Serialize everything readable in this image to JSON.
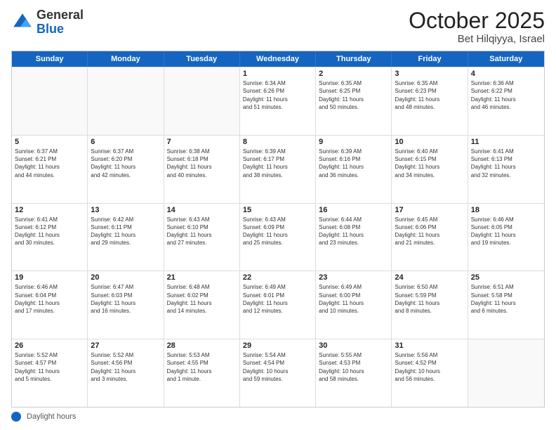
{
  "header": {
    "logo_general": "General",
    "logo_blue": "Blue",
    "month": "October 2025",
    "location": "Bet Hilqiyya, Israel"
  },
  "days_of_week": [
    "Sunday",
    "Monday",
    "Tuesday",
    "Wednesday",
    "Thursday",
    "Friday",
    "Saturday"
  ],
  "weeks": [
    [
      {
        "day": "",
        "info": ""
      },
      {
        "day": "",
        "info": ""
      },
      {
        "day": "",
        "info": ""
      },
      {
        "day": "1",
        "info": "Sunrise: 6:34 AM\nSunset: 6:26 PM\nDaylight: 11 hours\nand 51 minutes."
      },
      {
        "day": "2",
        "info": "Sunrise: 6:35 AM\nSunset: 6:25 PM\nDaylight: 11 hours\nand 50 minutes."
      },
      {
        "day": "3",
        "info": "Sunrise: 6:35 AM\nSunset: 6:23 PM\nDaylight: 11 hours\nand 48 minutes."
      },
      {
        "day": "4",
        "info": "Sunrise: 6:36 AM\nSunset: 6:22 PM\nDaylight: 11 hours\nand 46 minutes."
      }
    ],
    [
      {
        "day": "5",
        "info": "Sunrise: 6:37 AM\nSunset: 6:21 PM\nDaylight: 11 hours\nand 44 minutes."
      },
      {
        "day": "6",
        "info": "Sunrise: 6:37 AM\nSunset: 6:20 PM\nDaylight: 11 hours\nand 42 minutes."
      },
      {
        "day": "7",
        "info": "Sunrise: 6:38 AM\nSunset: 6:18 PM\nDaylight: 11 hours\nand 40 minutes."
      },
      {
        "day": "8",
        "info": "Sunrise: 6:39 AM\nSunset: 6:17 PM\nDaylight: 11 hours\nand 38 minutes."
      },
      {
        "day": "9",
        "info": "Sunrise: 6:39 AM\nSunset: 6:16 PM\nDaylight: 11 hours\nand 36 minutes."
      },
      {
        "day": "10",
        "info": "Sunrise: 6:40 AM\nSunset: 6:15 PM\nDaylight: 11 hours\nand 34 minutes."
      },
      {
        "day": "11",
        "info": "Sunrise: 6:41 AM\nSunset: 6:13 PM\nDaylight: 11 hours\nand 32 minutes."
      }
    ],
    [
      {
        "day": "12",
        "info": "Sunrise: 6:41 AM\nSunset: 6:12 PM\nDaylight: 11 hours\nand 30 minutes."
      },
      {
        "day": "13",
        "info": "Sunrise: 6:42 AM\nSunset: 6:11 PM\nDaylight: 11 hours\nand 29 minutes."
      },
      {
        "day": "14",
        "info": "Sunrise: 6:43 AM\nSunset: 6:10 PM\nDaylight: 11 hours\nand 27 minutes."
      },
      {
        "day": "15",
        "info": "Sunrise: 6:43 AM\nSunset: 6:09 PM\nDaylight: 11 hours\nand 25 minutes."
      },
      {
        "day": "16",
        "info": "Sunrise: 6:44 AM\nSunset: 6:08 PM\nDaylight: 11 hours\nand 23 minutes."
      },
      {
        "day": "17",
        "info": "Sunrise: 6:45 AM\nSunset: 6:06 PM\nDaylight: 11 hours\nand 21 minutes."
      },
      {
        "day": "18",
        "info": "Sunrise: 6:46 AM\nSunset: 6:05 PM\nDaylight: 11 hours\nand 19 minutes."
      }
    ],
    [
      {
        "day": "19",
        "info": "Sunrise: 6:46 AM\nSunset: 6:04 PM\nDaylight: 11 hours\nand 17 minutes."
      },
      {
        "day": "20",
        "info": "Sunrise: 6:47 AM\nSunset: 6:03 PM\nDaylight: 11 hours\nand 16 minutes."
      },
      {
        "day": "21",
        "info": "Sunrise: 6:48 AM\nSunset: 6:02 PM\nDaylight: 11 hours\nand 14 minutes."
      },
      {
        "day": "22",
        "info": "Sunrise: 6:49 AM\nSunset: 6:01 PM\nDaylight: 11 hours\nand 12 minutes."
      },
      {
        "day": "23",
        "info": "Sunrise: 6:49 AM\nSunset: 6:00 PM\nDaylight: 11 hours\nand 10 minutes."
      },
      {
        "day": "24",
        "info": "Sunrise: 6:50 AM\nSunset: 5:59 PM\nDaylight: 11 hours\nand 8 minutes."
      },
      {
        "day": "25",
        "info": "Sunrise: 6:51 AM\nSunset: 5:58 PM\nDaylight: 11 hours\nand 6 minutes."
      }
    ],
    [
      {
        "day": "26",
        "info": "Sunrise: 5:52 AM\nSunset: 4:57 PM\nDaylight: 11 hours\nand 5 minutes."
      },
      {
        "day": "27",
        "info": "Sunrise: 5:52 AM\nSunset: 4:56 PM\nDaylight: 11 hours\nand 3 minutes."
      },
      {
        "day": "28",
        "info": "Sunrise: 5:53 AM\nSunset: 4:55 PM\nDaylight: 11 hours\nand 1 minute."
      },
      {
        "day": "29",
        "info": "Sunrise: 5:54 AM\nSunset: 4:54 PM\nDaylight: 10 hours\nand 59 minutes."
      },
      {
        "day": "30",
        "info": "Sunrise: 5:55 AM\nSunset: 4:53 PM\nDaylight: 10 hours\nand 58 minutes."
      },
      {
        "day": "31",
        "info": "Sunrise: 5:56 AM\nSunset: 4:52 PM\nDaylight: 10 hours\nand 56 minutes."
      },
      {
        "day": "",
        "info": ""
      }
    ]
  ],
  "footer": {
    "label": "Daylight hours"
  }
}
